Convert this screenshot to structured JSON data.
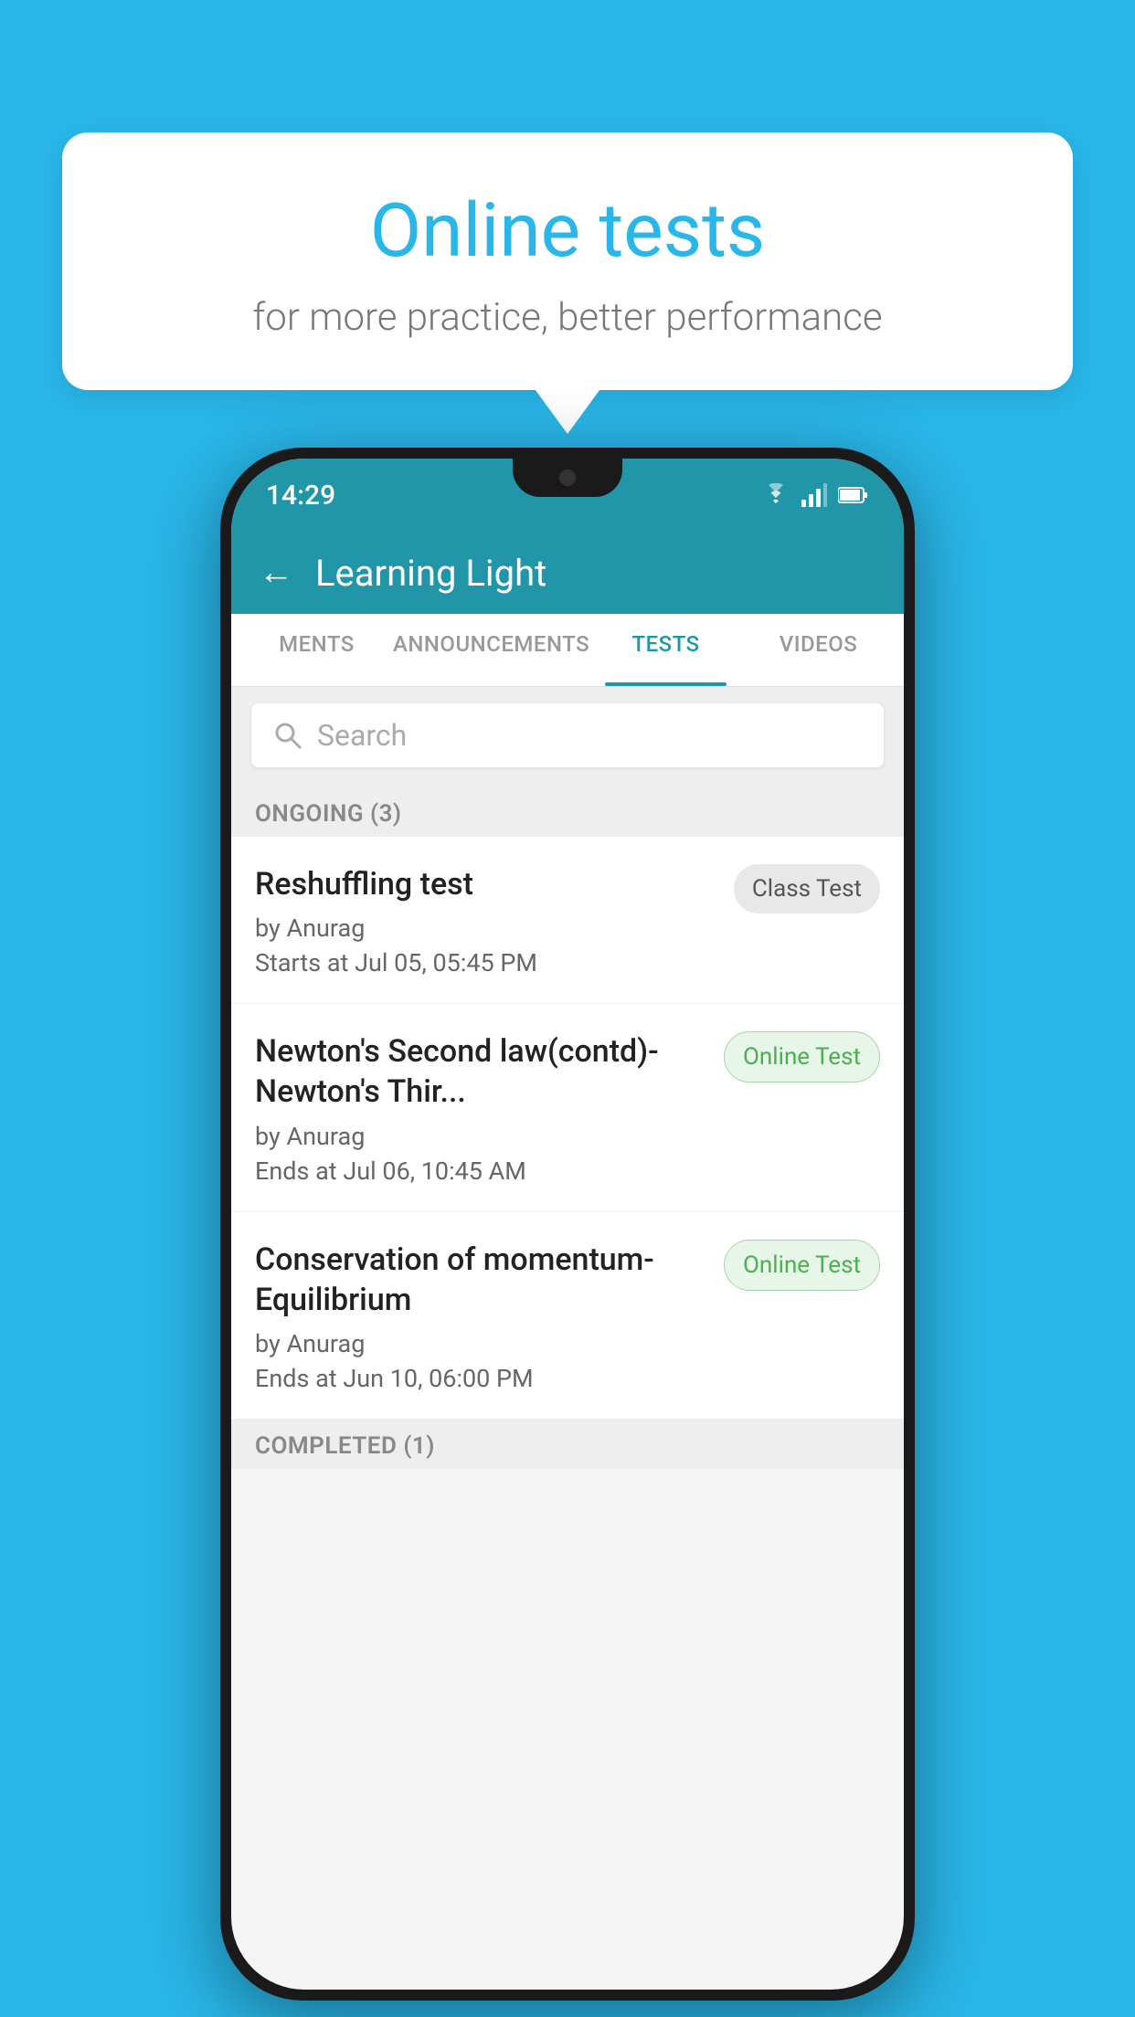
{
  "background_color": "#29b6e8",
  "bubble": {
    "title": "Online tests",
    "subtitle": "for more practice, better performance"
  },
  "phone": {
    "status_bar": {
      "time": "14:29",
      "icons": [
        "wifi",
        "signal",
        "battery"
      ]
    },
    "app_header": {
      "title": "Learning Light",
      "back_label": "←"
    },
    "tabs": [
      {
        "label": "MENTS",
        "active": false
      },
      {
        "label": "ANNOUNCEMENTS",
        "active": false
      },
      {
        "label": "TESTS",
        "active": true
      },
      {
        "label": "VIDEOS",
        "active": false
      }
    ],
    "search": {
      "placeholder": "Search"
    },
    "ongoing_section": {
      "label": "ONGOING (3)"
    },
    "tests": [
      {
        "name": "Reshuffling test",
        "author": "by Anurag",
        "time_label": "Starts at",
        "time": "Jul 05, 05:45 PM",
        "badge": "Class Test",
        "badge_type": "class"
      },
      {
        "name": "Newton's Second law(contd)-Newton's Thir...",
        "author": "by Anurag",
        "time_label": "Ends at",
        "time": "Jul 06, 10:45 AM",
        "badge": "Online Test",
        "badge_type": "online"
      },
      {
        "name": "Conservation of momentum-Equilibrium",
        "author": "by Anurag",
        "time_label": "Ends at",
        "time": "Jun 10, 06:00 PM",
        "badge": "Online Test",
        "badge_type": "online"
      }
    ],
    "completed_section": {
      "label": "COMPLETED (1)"
    }
  }
}
